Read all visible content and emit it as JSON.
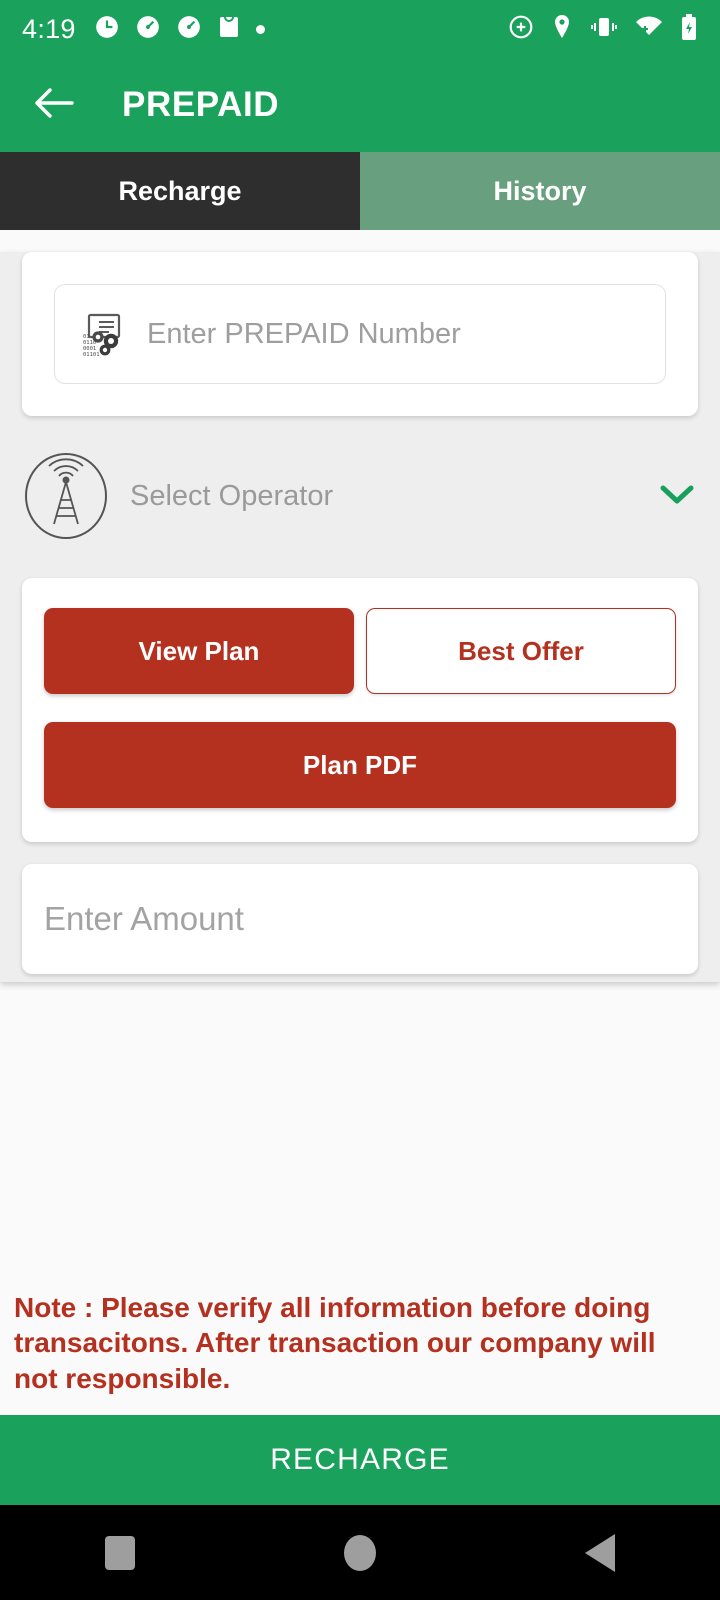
{
  "statusbar": {
    "time": "4:19",
    "left_icons": [
      "clock-icon",
      "speedometer-icon",
      "speedometer-icon",
      "shopping-bag-icon",
      "dot-indicator-icon"
    ],
    "right_icons": [
      "add-circle-icon",
      "location-pin-icon",
      "vibrate-icon",
      "wifi-icon",
      "battery-charging-icon"
    ]
  },
  "appbar": {
    "back_icon": "arrow-left-icon",
    "title": "PREPAID"
  },
  "tabs": {
    "items": [
      {
        "label": "Recharge",
        "active": true
      },
      {
        "label": "History",
        "active": false
      }
    ]
  },
  "form": {
    "number_field": {
      "placeholder": "Enter PREPAID Number",
      "value": "",
      "icon": "prepaid-document-gear-icon"
    },
    "operator": {
      "label": "Select Operator",
      "icon": "cell-tower-icon",
      "chevron": "chevron-down-icon"
    },
    "buttons": {
      "view_plan": "View Plan",
      "best_offer": "Best Offer",
      "plan_pdf": "Plan PDF"
    },
    "amount_field": {
      "placeholder": "Enter Amount",
      "value": ""
    }
  },
  "note": "Note : Please verify all information before doing transacitons. After transaction our company will not responsible.",
  "recharge_button": {
    "label": "RECHARGE"
  },
  "navbar": {
    "recents": "recents-square-icon",
    "home": "home-circle-icon",
    "back": "back-triangle-icon"
  },
  "colors": {
    "brand_green": "#1aa25c",
    "tab_inactive_green": "#68a07f",
    "tab_active_dark": "#2e2e2e",
    "accent_red": "#b4301f",
    "panel_grey": "#eeeeee",
    "page_bg": "#fafafa"
  }
}
